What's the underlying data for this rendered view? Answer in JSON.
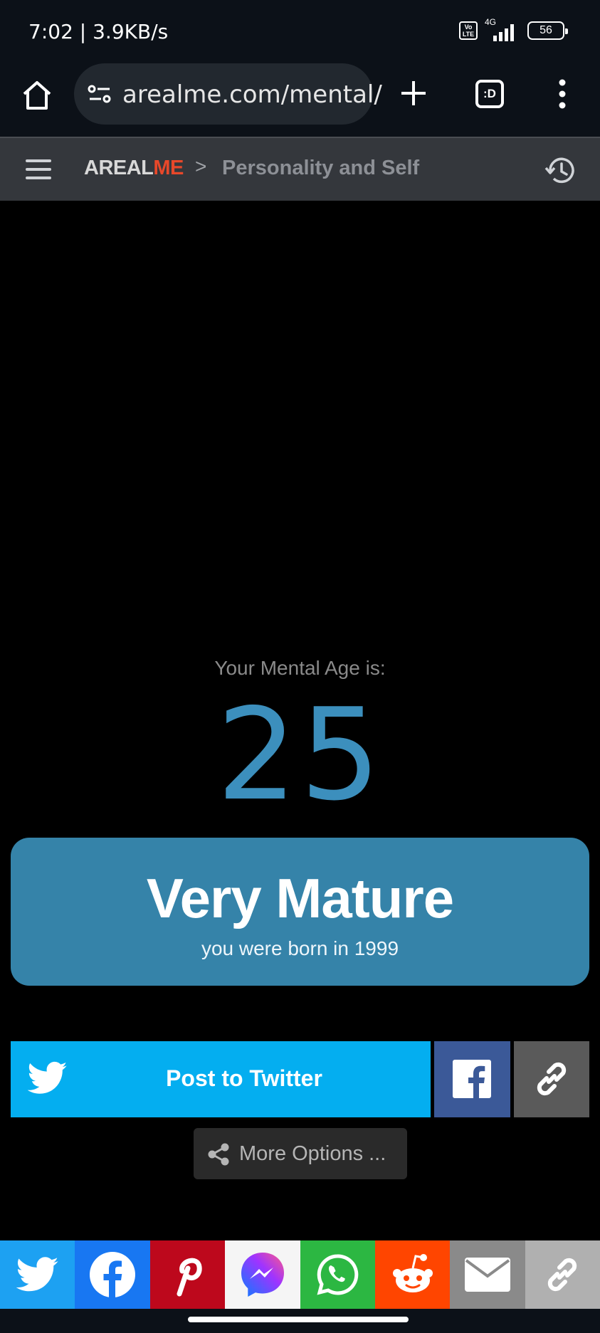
{
  "status_bar": {
    "time": "7:02 | 3.9KB/s",
    "volte": "Vo LTE",
    "network": "4G",
    "battery": "56"
  },
  "browser": {
    "url": "arealme.com/mental/",
    "tabs_label": ":D",
    "icons": [
      "home-icon",
      "site-settings-icon",
      "plus-icon",
      "tabs-icon",
      "more-vert-icon"
    ]
  },
  "site_header": {
    "logo_part1": "AREAL",
    "logo_part2": "ME",
    "separator": ">",
    "breadcrumb": "Personality and Self",
    "colors": {
      "logo_accent": "#e8482a",
      "header_bg": "#34373c"
    }
  },
  "result": {
    "label": "Your Mental Age is:",
    "age": "25",
    "verdict": "Very Mature",
    "subtitle": "you were born in 1999",
    "colors": {
      "age": "#3c8fbd",
      "card": "#3583a9"
    }
  },
  "share": {
    "twitter_label": "Post to Twitter",
    "more_label": "More Options ...",
    "colors": {
      "twitter": "#04aef0",
      "facebook": "#3b5998",
      "link": "#5a5a5a"
    }
  },
  "share_strip": [
    {
      "name": "twitter",
      "color": "#1da1f2"
    },
    {
      "name": "facebook",
      "color": "#1877f2"
    },
    {
      "name": "pinterest",
      "color": "#bd081c"
    },
    {
      "name": "messenger",
      "color": "#f5f5f5"
    },
    {
      "name": "whatsapp",
      "color": "#2cb742"
    },
    {
      "name": "reddit",
      "color": "#ff4500"
    },
    {
      "name": "email",
      "color": "#8a8a8a"
    },
    {
      "name": "copy-link",
      "color": "#b0b0b0"
    }
  ]
}
